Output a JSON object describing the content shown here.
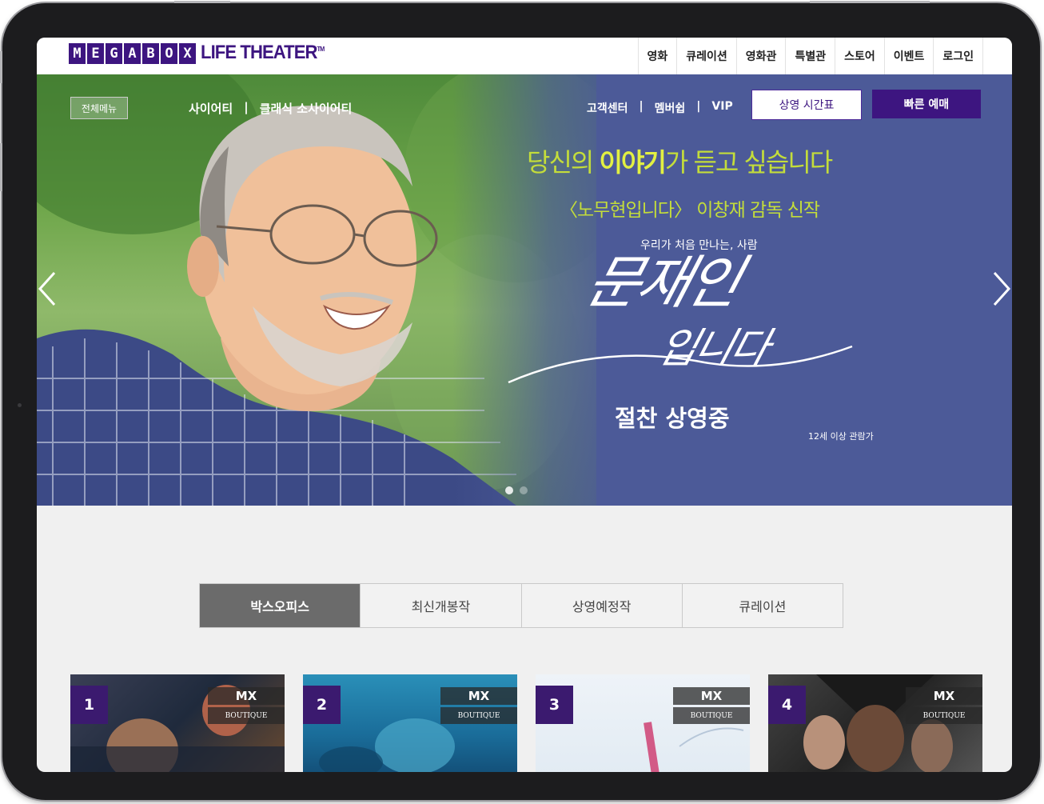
{
  "header": {
    "logo_letters": [
      "M",
      "E",
      "G",
      "A",
      "B",
      "O",
      "X"
    ],
    "logo_sub": "LIFE THEATER",
    "logo_tm": "TM",
    "nav": [
      "영화",
      "큐레이션",
      "영화관",
      "특별관",
      "스토어",
      "이벤트",
      "로그인"
    ]
  },
  "hero": {
    "menu_button": "전체메뉴",
    "society_links": [
      "사이어티",
      "클래식 소사이어티"
    ],
    "util_links": [
      "고객센터",
      "멤버쉽",
      "VIP"
    ],
    "schedule_button": "상영 시간표",
    "quick_button": "빠른 예매",
    "line1_a": "당신의 ",
    "line1_b": "이야기",
    "line1_c": "가 듣고 싶습니다",
    "line2": "〈노무현입니다〉 이창재 감독 신작",
    "line3": "우리가 처음 만나는, 사람",
    "title_top": "문재인",
    "title_bottom": "입니다",
    "now_showing": "절찬 상영중",
    "rating": "12세 이상 관람가",
    "slide_count": 2,
    "active_slide": 1
  },
  "tabs": [
    "박스오피스",
    "최신개봉작",
    "상영예정작",
    "큐레이션"
  ],
  "active_tab": 0,
  "movies": [
    {
      "rank": "1",
      "badge": "MX",
      "badge_sub": "BOUTIQUE"
    },
    {
      "rank": "2",
      "badge": "MX",
      "badge_sub": "BOUTIQUE"
    },
    {
      "rank": "3",
      "badge": "MX",
      "badge_sub": "BOUTIQUE"
    },
    {
      "rank": "4",
      "badge": "MX",
      "badge_sub": "BOUTIQUE"
    }
  ],
  "colors": {
    "brand_purple": "#3d1580",
    "hero_blue": "#4c5a98",
    "headline_green": "#c4dd3a",
    "tab_active": "#6b6b6b"
  }
}
